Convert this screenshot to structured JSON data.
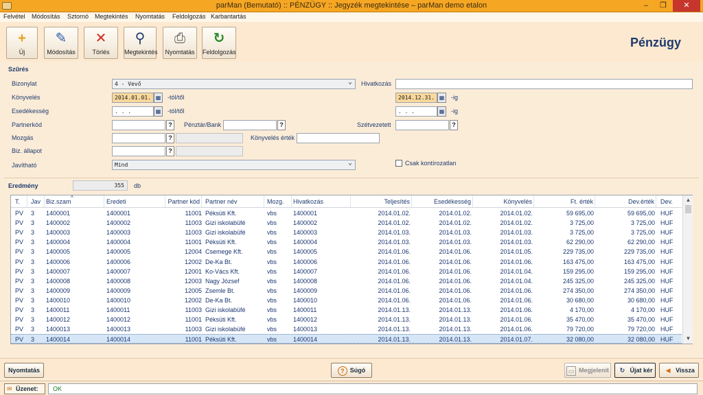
{
  "window": {
    "title": "parMan (Bemutató) :: PÉNZÜGY :: Jegyzék megtekintése   –   parMan demo etalon",
    "minimize": "–",
    "maximize": "❐",
    "close": "✕"
  },
  "menu": [
    "Felvétel",
    "Módosítás",
    "Sztornó",
    "Megtekintés",
    "Nyomtatás",
    "Feldolgozás",
    "Karbantartás"
  ],
  "toolbar": {
    "buttons": [
      {
        "label": "Új",
        "icon": "plus-icon"
      },
      {
        "label": "Módosítás",
        "icon": "pencil-icon"
      },
      {
        "label": "Törlés",
        "icon": "delete-icon"
      },
      {
        "label": "Megtekintés",
        "icon": "magnifier-icon"
      },
      {
        "label": "Nyomtatás",
        "icon": "printer-icon"
      },
      {
        "label": "Feldolgozás",
        "icon": "process-icon"
      }
    ],
    "heading": "Pénzügy"
  },
  "filter": {
    "title": "Szűrés",
    "bizonylat": {
      "label": "Bizonylat",
      "value": "4 - Vevő"
    },
    "hivatkozas": {
      "label": "Hivatkozás",
      "value": ""
    },
    "konyveles": {
      "label": "Könyvelés",
      "from": "2014.01.01.",
      "from_suffix": "-tól/től",
      "to": "2014.12.31.",
      "to_suffix": "-ig"
    },
    "esedekesseg": {
      "label": "Esedékesség",
      "from": " .  .  .",
      "from_suffix": "-tól/től",
      "to": " .  .  .",
      "to_suffix": "-ig"
    },
    "partnerkod": {
      "label": "Partnerkód",
      "value": ""
    },
    "penztar": {
      "label": "Pénztár/Bank",
      "value": ""
    },
    "szetvezetett": {
      "label": "Szétvezetett",
      "value": ""
    },
    "mozgas": {
      "label": "Mozgás",
      "value": ""
    },
    "konyveles_ertek": {
      "label": "Könyvelés érték",
      "value": ""
    },
    "biz_allapot": {
      "label": "Biz. állapot",
      "value": ""
    },
    "javithato": {
      "label": "Javítható",
      "value": "Mind"
    },
    "csak_kontirozatlan": {
      "label": "Csak kontírozatlan",
      "checked": false
    },
    "q": "?"
  },
  "result": {
    "label": "Eredmény",
    "count": "355",
    "unit": "db"
  },
  "grid": {
    "columns": [
      "T.",
      "Jav",
      "Biz.szam",
      "Eredeti",
      "Partner kód",
      "Partner név",
      "Mozg.",
      "Hivatkozás",
      "Teljesítés",
      "Esedékesség",
      "Könyvelés",
      "Ft. érték",
      "Dev.érték",
      "Dev."
    ],
    "rows": [
      [
        "PV",
        "3",
        "1400001",
        "1400001",
        "11001",
        "Péksüti Kft.",
        "vbs",
        "1400001",
        "2014.01.02.",
        "2014.01.02.",
        "2014.01.02.",
        "59 695,00",
        "59 695,00",
        "HUF"
      ],
      [
        "PV",
        "3",
        "1400002",
        "1400002",
        "11003",
        "Gizi iskolabüfé",
        "vbs",
        "1400002",
        "2014.01.02.",
        "2014.01.02.",
        "2014.01.02.",
        "3 725,00",
        "3 725,00",
        "HUF"
      ],
      [
        "PV",
        "3",
        "1400003",
        "1400003",
        "11003",
        "Gizi iskolabüfé",
        "vbs",
        "1400003",
        "2014.01.03.",
        "2014.01.03.",
        "2014.01.03.",
        "3 725,00",
        "3 725,00",
        "HUF"
      ],
      [
        "PV",
        "3",
        "1400004",
        "1400004",
        "11001",
        "Péksüti Kft.",
        "vbs",
        "1400004",
        "2014.01.03.",
        "2014.01.03.",
        "2014.01.03.",
        "62 290,00",
        "62 290,00",
        "HUF"
      ],
      [
        "PV",
        "3",
        "1400005",
        "1400005",
        "12004",
        "Csemege Kft.",
        "vbs",
        "1400005",
        "2014.01.06.",
        "2014.01.06.",
        "2014.01.05.",
        "229 735,00",
        "229 735,00",
        "HUF"
      ],
      [
        "PV",
        "3",
        "1400006",
        "1400006",
        "12002",
        "De-Ka Bt.",
        "vbs",
        "1400006",
        "2014.01.06.",
        "2014.01.06.",
        "2014.01.06.",
        "163 475,00",
        "163 475,00",
        "HUF"
      ],
      [
        "PV",
        "3",
        "1400007",
        "1400007",
        "12001",
        "Ko-Vács Kft.",
        "vbs",
        "1400007",
        "2014.01.06.",
        "2014.01.06.",
        "2014.01.04.",
        "159 295,00",
        "159 295,00",
        "HUF"
      ],
      [
        "PV",
        "3",
        "1400008",
        "1400008",
        "12003",
        "Nagy József",
        "vbs",
        "1400008",
        "2014.01.06.",
        "2014.01.06.",
        "2014.01.04.",
        "245 325,00",
        "245 325,00",
        "HUF"
      ],
      [
        "PV",
        "3",
        "1400009",
        "1400009",
        "12005",
        "Zsemle Bt.",
        "vbs",
        "1400009",
        "2014.01.06.",
        "2014.01.06.",
        "2014.01.06.",
        "274 350,00",
        "274 350,00",
        "HUF"
      ],
      [
        "PV",
        "3",
        "1400010",
        "1400010",
        "12002",
        "De-Ka Bt.",
        "vbs",
        "1400010",
        "2014.01.06.",
        "2014.01.06.",
        "2014.01.06.",
        "30 680,00",
        "30 680,00",
        "HUF"
      ],
      [
        "PV",
        "3",
        "1400011",
        "1400011",
        "11003",
        "Gizi iskolabüfé",
        "vbs",
        "1400011",
        "2014.01.13.",
        "2014.01.13.",
        "2014.01.06.",
        "4 170,00",
        "4 170,00",
        "HUF"
      ],
      [
        "PV",
        "3",
        "1400012",
        "1400012",
        "11001",
        "Péksüti Kft.",
        "vbs",
        "1400012",
        "2014.01.13.",
        "2014.01.13.",
        "2014.01.06.",
        "35 470,00",
        "35 470,00",
        "HUF"
      ],
      [
        "PV",
        "3",
        "1400013",
        "1400013",
        "11003",
        "Gizi iskolabüfé",
        "vbs",
        "1400013",
        "2014.01.13.",
        "2014.01.13.",
        "2014.01.06.",
        "79 720,00",
        "79 720,00",
        "HUF"
      ],
      [
        "PV",
        "3",
        "1400014",
        "1400014",
        "11001",
        "Péksüti Kft.",
        "vbs",
        "1400014",
        "2014.01.13.",
        "2014.01.13.",
        "2014.01.07.",
        "32 080,00",
        "32 080,00",
        "HUF"
      ]
    ],
    "selected_row": 13,
    "sort_indicator": "^"
  },
  "bottom": {
    "print": "Nyomtatás",
    "help": "Súgó",
    "display": "Megjelenít",
    "new_query": "Újat kér",
    "back": "Vissza"
  },
  "status": {
    "label": "Üzenet:",
    "value": "OK"
  },
  "colors": {
    "titlebar": "#f5a623",
    "background": "#fbecd8",
    "heading": "#1f3b6e",
    "date_field": "#f8d89c",
    "close": "#c7362d",
    "status_ok": "#1e7a1e"
  }
}
